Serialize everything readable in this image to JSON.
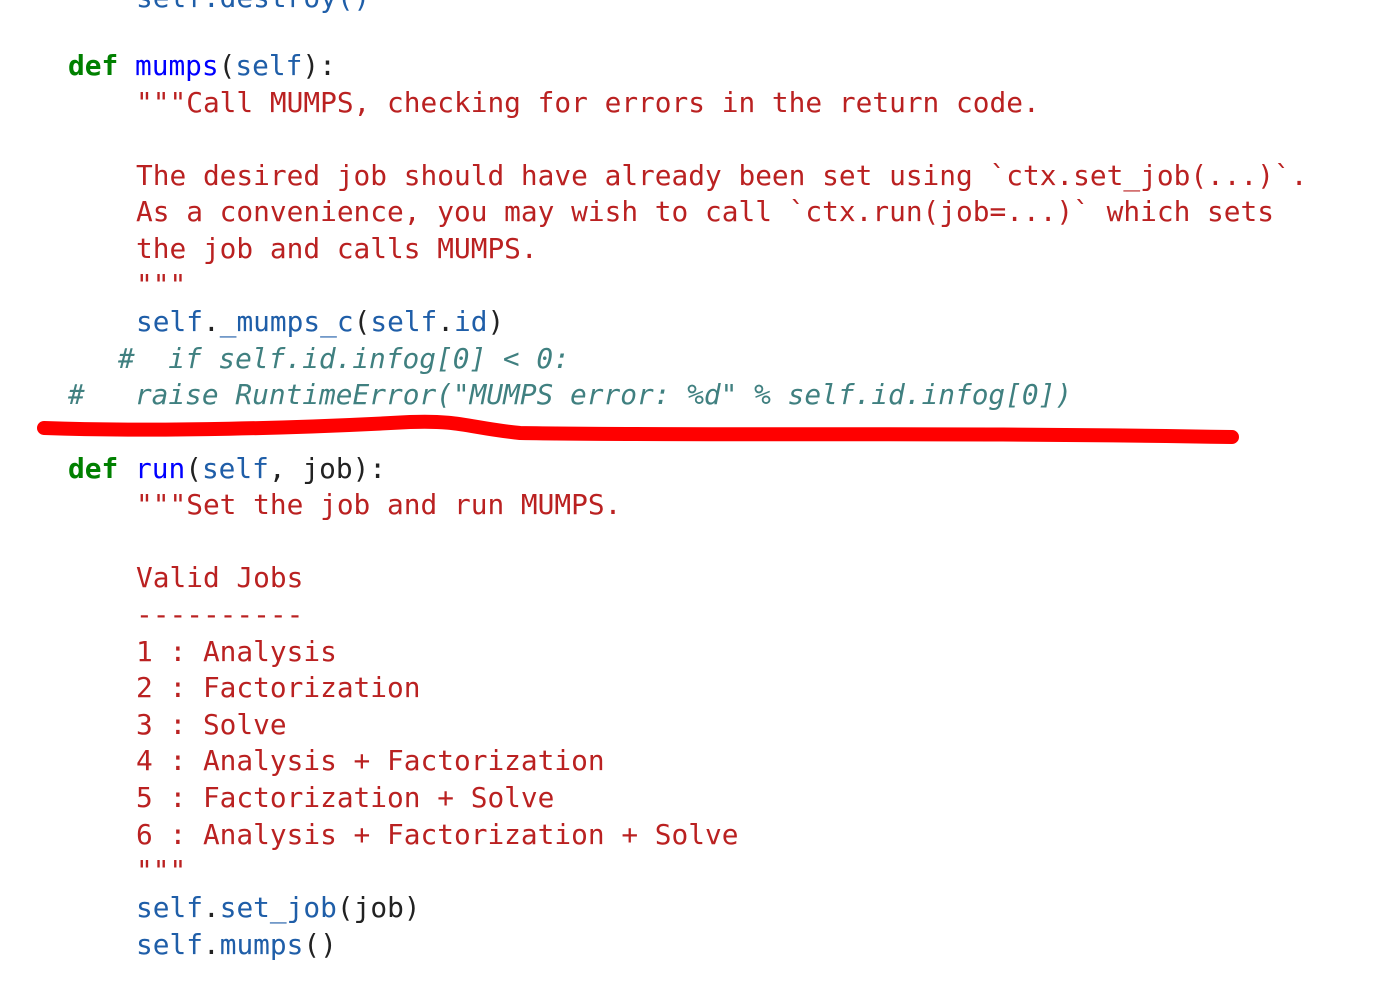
{
  "code": {
    "top_partial": "self.destroy()",
    "mumps_def": {
      "keyword": "def",
      "name": "mumps",
      "open_paren": "(",
      "param": "self",
      "close": "):"
    },
    "mumps_doc": [
      "\"\"\"Call MUMPS, checking for errors in the return code.",
      "The desired job should have already been set using `ctx.set_job(...)`.",
      "As a convenience, you may wish to call `ctx.run(job=...)` which sets",
      "the job and calls MUMPS.",
      "\"\"\""
    ],
    "mumps_call": {
      "self": "self",
      "dot": ".",
      "method": "_mumps_c",
      "open": "(",
      "arg_self": "self",
      "arg_dot": ".",
      "arg_attr": "id",
      "close": ")"
    },
    "comment_1": "#  if self.id.infog[0] < 0:",
    "comment_2": "#   raise RuntimeError(\"MUMPS error: %d\" % self.id.infog[0])",
    "run_def": {
      "keyword": "def",
      "name": "run",
      "open_paren": "(",
      "param_self": "self",
      "rest": ", job):"
    },
    "run_doc": [
      "\"\"\"Set the job and run MUMPS.",
      "Valid Jobs",
      "----------",
      "1 : Analysis",
      "2 : Factorization",
      "3 : Solve",
      "4 : Analysis + Factorization",
      "5 : Factorization + Solve",
      "6 : Analysis + Factorization + Solve",
      "\"\"\""
    ],
    "set_job_call": {
      "self": "self",
      "dot": ".",
      "method": "set_job",
      "args": "(job)"
    },
    "mumps_self_call": {
      "self": "self",
      "dot": ".",
      "method": "mumps",
      "args": "()"
    }
  },
  "colors": {
    "keyword": "#008000",
    "function_name": "#0000ff",
    "self": "#1f5ea8",
    "string": "#ba2121",
    "comment": "#408080",
    "annotation_line": "#ff0000"
  }
}
